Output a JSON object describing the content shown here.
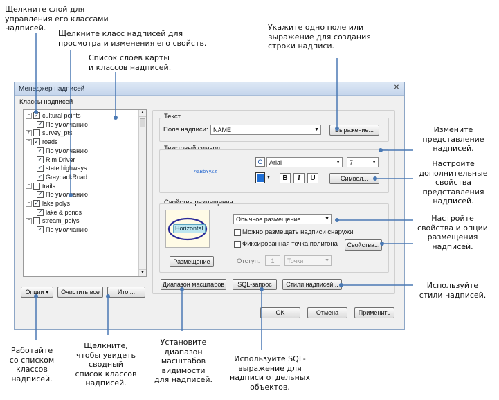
{
  "callouts": {
    "layer_click": "Щелкните слой для\nуправления его классами\nнадписей.",
    "class_click": "Щелкните класс надписей для\nпросмотра и изменения его свойств.",
    "list": "Список слоёв карты\nи классов надписей.",
    "field": "Укажите одно поле или\nвыражение для создания\nстроки надписи.",
    "symbol_change": "Измените\nпредставление\nнадписей.",
    "symbol_more": "Настройте\nдополнительные\nсвойства\nпредставления\nнадписей.",
    "placement": "Настройте\nсвойства и опции\nразмещения\nнадписей.",
    "styles": "Используйте\nстили надписей.",
    "options": "Работайте\nсо списком\nклассов\nнадписей.",
    "summary": "Щелкните,\nчтобы увидеть\nсводный\nсписок классов\nнадписей.",
    "scale": "Установите\nдиапазон\nмасштабов\nвидимости\nдля надписей.",
    "sql": "Используйте SQL-\nвыражение для\nнадписи отдельных\nобъектов."
  },
  "dialog": {
    "title": "Менеджер надписей",
    "close_glyph": "✕",
    "classes_label": "Классы надписей",
    "tree": [
      {
        "label": "cultural points",
        "level": 0,
        "expander": "−",
        "checked": true
      },
      {
        "label": "По умолчанию",
        "level": 1,
        "expander": "",
        "checked": true
      },
      {
        "label": "survey_pts",
        "level": 0,
        "expander": "+",
        "checked": false
      },
      {
        "label": "roads",
        "level": 0,
        "expander": "−",
        "checked": true
      },
      {
        "label": "По умолчанию",
        "level": 1,
        "expander": "",
        "checked": true
      },
      {
        "label": "Rim Driver",
        "level": 1,
        "expander": "",
        "checked": true
      },
      {
        "label": "state highways",
        "level": 1,
        "expander": "",
        "checked": true
      },
      {
        "label": "GraybackRoad",
        "level": 1,
        "expander": "",
        "checked": true
      },
      {
        "label": "trails",
        "level": 0,
        "expander": "−",
        "checked": false
      },
      {
        "label": "По умолчанию",
        "level": 1,
        "expander": "",
        "checked": true
      },
      {
        "label": "lake polys",
        "level": 0,
        "expander": "−",
        "checked": true
      },
      {
        "label": "lake & ponds",
        "level": 1,
        "expander": "",
        "checked": true
      },
      {
        "label": "stream_polys",
        "level": 0,
        "expander": "−",
        "checked": false
      },
      {
        "label": "По умолчанию",
        "level": 1,
        "expander": "",
        "checked": true
      }
    ],
    "buttons": {
      "options": "Опции ▾",
      "clear_all": "Очистить все",
      "summary": "Итог...",
      "scale_range": "Диапазон масштабов",
      "sql": "SQL-запрос",
      "styles": "Стили надписей...",
      "ok": "OK",
      "cancel": "Отмена",
      "apply": "Применить"
    },
    "text_group": {
      "title": "Текст",
      "field_label": "Поле надписи:",
      "field_value": "NAME",
      "expression_button": "Выражение..."
    },
    "symbol_group": {
      "title": "Текстовый символ",
      "preview": "AaBbYyZz",
      "font": "Arial",
      "size": "7",
      "bold": "B",
      "italic": "I",
      "underline": "U",
      "symbol_button": "Символ...",
      "font_glyph": "O",
      "color": "#1f6fd6"
    },
    "placement_group": {
      "title": "Свойства размещения",
      "preview_text": "Horizontal",
      "placement_button": "Размещение",
      "mode": "Обычное размещение",
      "option_outside": "Можно размещать надписи снаружи",
      "option_fixed": "Фиксированная точка полигона",
      "props_button": "Свойства...",
      "offset_label": "Отступ:",
      "offset_value": "1",
      "offset_unit": "Точки"
    }
  }
}
